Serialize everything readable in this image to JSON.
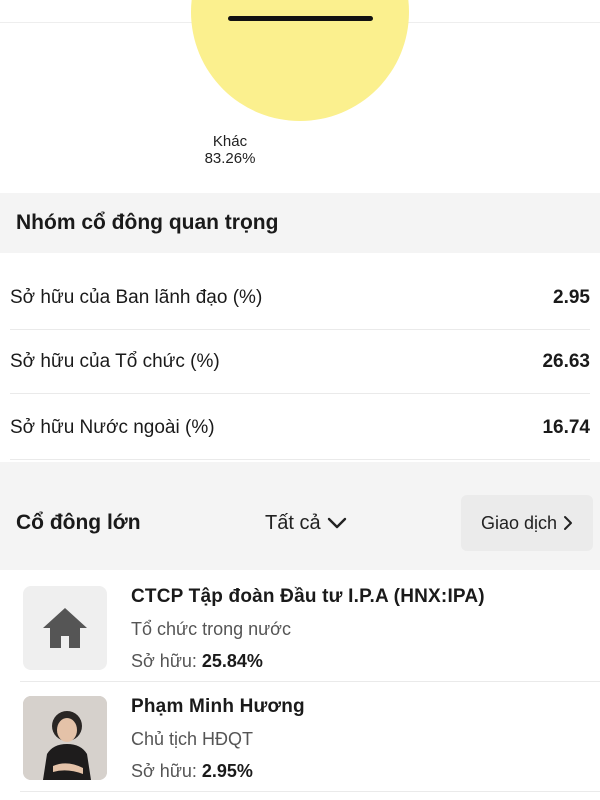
{
  "pie": {
    "slice_label": "Khác",
    "slice_value": "83.26%",
    "slice_color": "#fbf08e"
  },
  "key_holders": {
    "title": "Nhóm cổ đông quan trọng",
    "rows": [
      {
        "label": "Sở hữu của Ban lãnh đạo (%)",
        "value": "2.95"
      },
      {
        "label": "Sở hữu của Tổ chức (%)",
        "value": "26.63"
      },
      {
        "label": "Sở hữu Nước ngoài (%)",
        "value": "16.74"
      }
    ]
  },
  "major_holders": {
    "title": "Cổ đông lớn",
    "filter_label": "Tất cả",
    "trade_label": "Giao dịch",
    "items": [
      {
        "name": "CTCP Tập đoàn Đầu tư I.P.A (HNX:IPA)",
        "type": "Tổ chức trong nước",
        "own_label": "Sở hữu:",
        "own_value": "25.84%",
        "icon": "home-icon"
      },
      {
        "name": "Phạm Minh Hương",
        "type": "Chủ tịch HĐQT",
        "own_label": "Sở hữu:",
        "own_value": "2.95%",
        "icon": "person-photo"
      }
    ]
  }
}
